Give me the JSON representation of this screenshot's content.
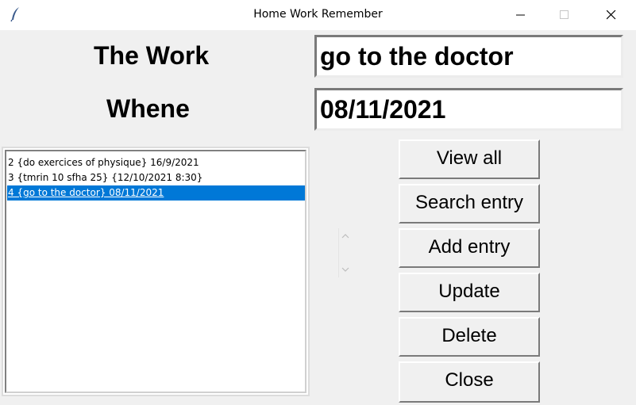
{
  "window": {
    "title": "Home Work Remember"
  },
  "form": {
    "work_label": "The Work",
    "work_value": "go to the doctor",
    "when_label": "Whene",
    "when_value": "08/11/2021"
  },
  "list": {
    "items": [
      {
        "text": "2 {do exercices of physique} 16/9/2021",
        "selected": false
      },
      {
        "text": "3 {tmrin 10 sfha 25} {12/10/2021 8:30}",
        "selected": false
      },
      {
        "text": "4 {go to the doctor} 08/11/2021",
        "selected": true
      }
    ]
  },
  "buttons": {
    "view_all": "View all",
    "search": "Search entry",
    "add": "Add entry",
    "update": "Update",
    "delete": "Delete",
    "close": "Close"
  },
  "icons": {
    "app": "feather-icon",
    "minimize": "minimize-icon",
    "maximize": "maximize-icon",
    "close": "close-icon",
    "scroll_up": "chevron-up-icon",
    "scroll_down": "chevron-down-icon"
  },
  "colors": {
    "selection": "#0078d7",
    "background": "#f0f0f0"
  }
}
